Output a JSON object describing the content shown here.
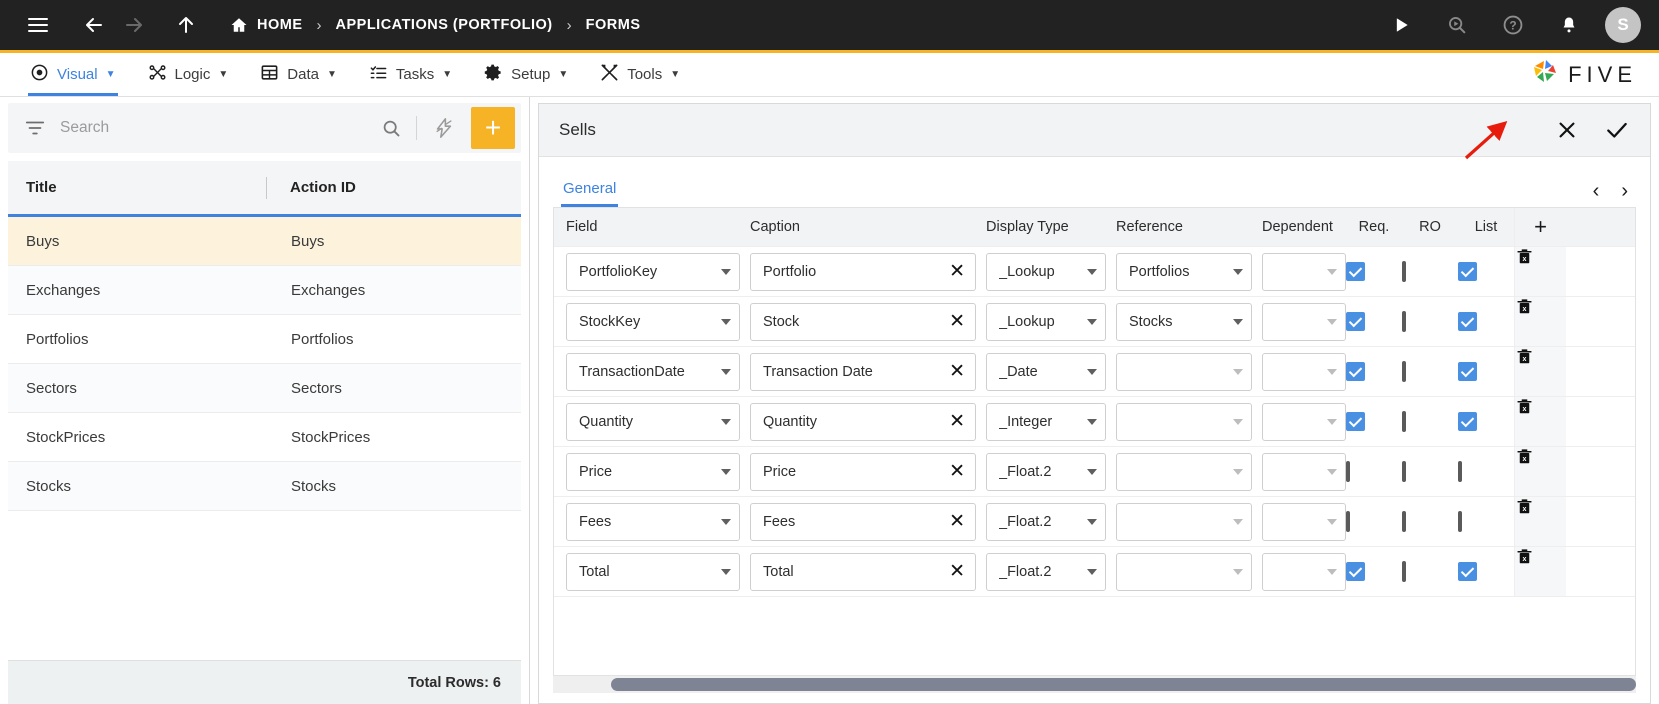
{
  "topbar": {
    "icons": [
      "hamburger-icon",
      "back-arrow-icon",
      "forward-arrow-icon",
      "up-arrow-icon"
    ],
    "breadcrumbs": [
      {
        "label": "HOME",
        "icon": "home-icon"
      },
      {
        "label": "APPLICATIONS (PORTFOLIO)"
      },
      {
        "label": "FORMS"
      }
    ],
    "separator": "›",
    "right_icons": [
      "run-play-icon",
      "search-debug-icon",
      "help-icon",
      "notifications-bell-icon"
    ],
    "avatar_initial": "S",
    "accent_color": "#f5b325"
  },
  "menubar": {
    "items": [
      {
        "label": "Visual",
        "icon": "eye-icon",
        "active": true
      },
      {
        "label": "Logic",
        "icon": "nodes-icon",
        "active": false
      },
      {
        "label": "Data",
        "icon": "table-icon",
        "active": false
      },
      {
        "label": "Tasks",
        "icon": "checklist-icon",
        "active": false
      },
      {
        "label": "Setup",
        "icon": "gear-icon",
        "active": false
      },
      {
        "label": "Tools",
        "icon": "wrench-icon",
        "active": false
      }
    ],
    "caret": "▼",
    "brand": "FIVE",
    "active_color": "#3d83df"
  },
  "sidebar": {
    "search": {
      "placeholder": "Search",
      "value": ""
    },
    "toolbar_icons": [
      "filter-icon",
      "search-icon",
      "lightning-icon"
    ],
    "add_label": "+",
    "columns": [
      "Title",
      "Action ID"
    ],
    "rows": [
      {
        "title": "Buys",
        "action_id": "Buys",
        "selected": true
      },
      {
        "title": "Exchanges",
        "action_id": "Exchanges",
        "selected": false
      },
      {
        "title": "Portfolios",
        "action_id": "Portfolios",
        "selected": false
      },
      {
        "title": "Sectors",
        "action_id": "Sectors",
        "selected": false
      },
      {
        "title": "StockPrices",
        "action_id": "StockPrices",
        "selected": false
      },
      {
        "title": "Stocks",
        "action_id": "Stocks",
        "selected": false
      }
    ],
    "footer": "Total Rows: 6"
  },
  "detail": {
    "title": "Sells",
    "header_actions": [
      {
        "name": "close-icon",
        "glyph": "✕"
      },
      {
        "name": "save-check-icon",
        "glyph": "✓"
      }
    ],
    "tabs": [
      {
        "label": "General",
        "active": true
      }
    ],
    "pager": {
      "prev": "‹",
      "next": "›"
    },
    "columns": [
      "Field",
      "Caption",
      "Display Type",
      "Reference",
      "Dependent",
      "Req.",
      "RO",
      "List",
      "+"
    ],
    "rows": [
      {
        "field": "PortfolioKey",
        "caption": "Portfolio",
        "display_type": "_Lookup",
        "reference": "Portfolios",
        "dependent": "",
        "req": true,
        "ro": false,
        "list": true
      },
      {
        "field": "StockKey",
        "caption": "Stock",
        "display_type": "_Lookup",
        "reference": "Stocks",
        "dependent": "",
        "req": true,
        "ro": false,
        "list": true
      },
      {
        "field": "TransactionDate",
        "caption": "Transaction Date",
        "display_type": "_Date",
        "reference": "",
        "dependent": "",
        "req": true,
        "ro": false,
        "list": true
      },
      {
        "field": "Quantity",
        "caption": "Quantity",
        "display_type": "_Integer",
        "reference": "",
        "dependent": "",
        "req": true,
        "ro": false,
        "list": true
      },
      {
        "field": "Price",
        "caption": "Price",
        "display_type": "_Float.2",
        "reference": "",
        "dependent": "",
        "req": false,
        "ro": false,
        "list": false
      },
      {
        "field": "Fees",
        "caption": "Fees",
        "display_type": "_Float.2",
        "reference": "",
        "dependent": "",
        "req": false,
        "ro": false,
        "list": false
      },
      {
        "field": "Total",
        "caption": "Total",
        "display_type": "_Float.2",
        "reference": "",
        "dependent": "",
        "req": true,
        "ro": false,
        "list": true
      }
    ],
    "clear_glyph": "✕",
    "delete_icon": "delete-row-icon",
    "add_column_label": "+"
  },
  "annotation": {
    "type": "red-arrow",
    "points_to": "save-check-icon",
    "color": "#e81c0d"
  }
}
